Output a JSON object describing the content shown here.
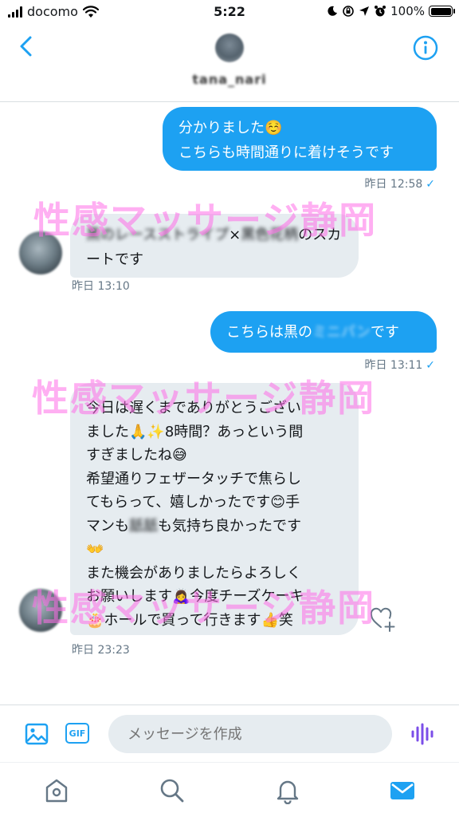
{
  "status_bar": {
    "carrier": "docomo",
    "time": "5:22",
    "battery": "100%",
    "battery_level": 1.0
  },
  "header": {
    "username": "tana_nari",
    "icons": [
      "back-chevron-icon",
      "info-icon"
    ]
  },
  "messages": [
    {
      "direction": "sent",
      "lines": [
        "分かりました☺️",
        "こちらも時間通りに着けそうです"
      ],
      "timestamp": "昨日 12:58",
      "read_check": "✓"
    },
    {
      "direction": "received",
      "parts": {
        "blurred_1": "黒のレースストライプ",
        "text_1": "×",
        "blurred_2": "黒色花柄",
        "text_2": "のスカ",
        "line_2": "ートです"
      },
      "timestamp": "昨日 13:10"
    },
    {
      "direction": "sent",
      "parts": {
        "text_1": "こちらは黒の",
        "blurred": "ミニパン",
        "text_2": "です"
      },
      "timestamp": "昨日 13:11",
      "read_check": "✓"
    },
    {
      "direction": "received",
      "lines": [
        "今日は遅くまでありがとうござい",
        "ました🙏✨8時間？あっという間",
        "すぎましたね😅",
        "希望通りフェザータッチで焦らし",
        "てもらって、嬉しかったです😊手",
        "マンも",
        "も気持ち良かったです",
        "👐",
        "また機会がありましたらよろしく",
        "お願いします🙇‍♀️今度チーズケーキ",
        "🎂ホールで買って行きます👍笑"
      ],
      "blurred_word": "舐舐",
      "timestamp": "昨日 23:23"
    }
  ],
  "watermark": "性感マッサージ静岡",
  "composer": {
    "placeholder": "メッセージを作成",
    "gif_label": "GIF"
  },
  "tabbar": {
    "tabs": [
      "home-icon",
      "search-icon",
      "notifications-bell-icon",
      "messages-envelope-icon"
    ],
    "active": "messages-envelope-icon"
  },
  "colors": {
    "accent": "#1da1f2",
    "received_bubble": "#e6ecf0",
    "watermark": "#ff6ee8",
    "voice": "#7b4ee8"
  }
}
